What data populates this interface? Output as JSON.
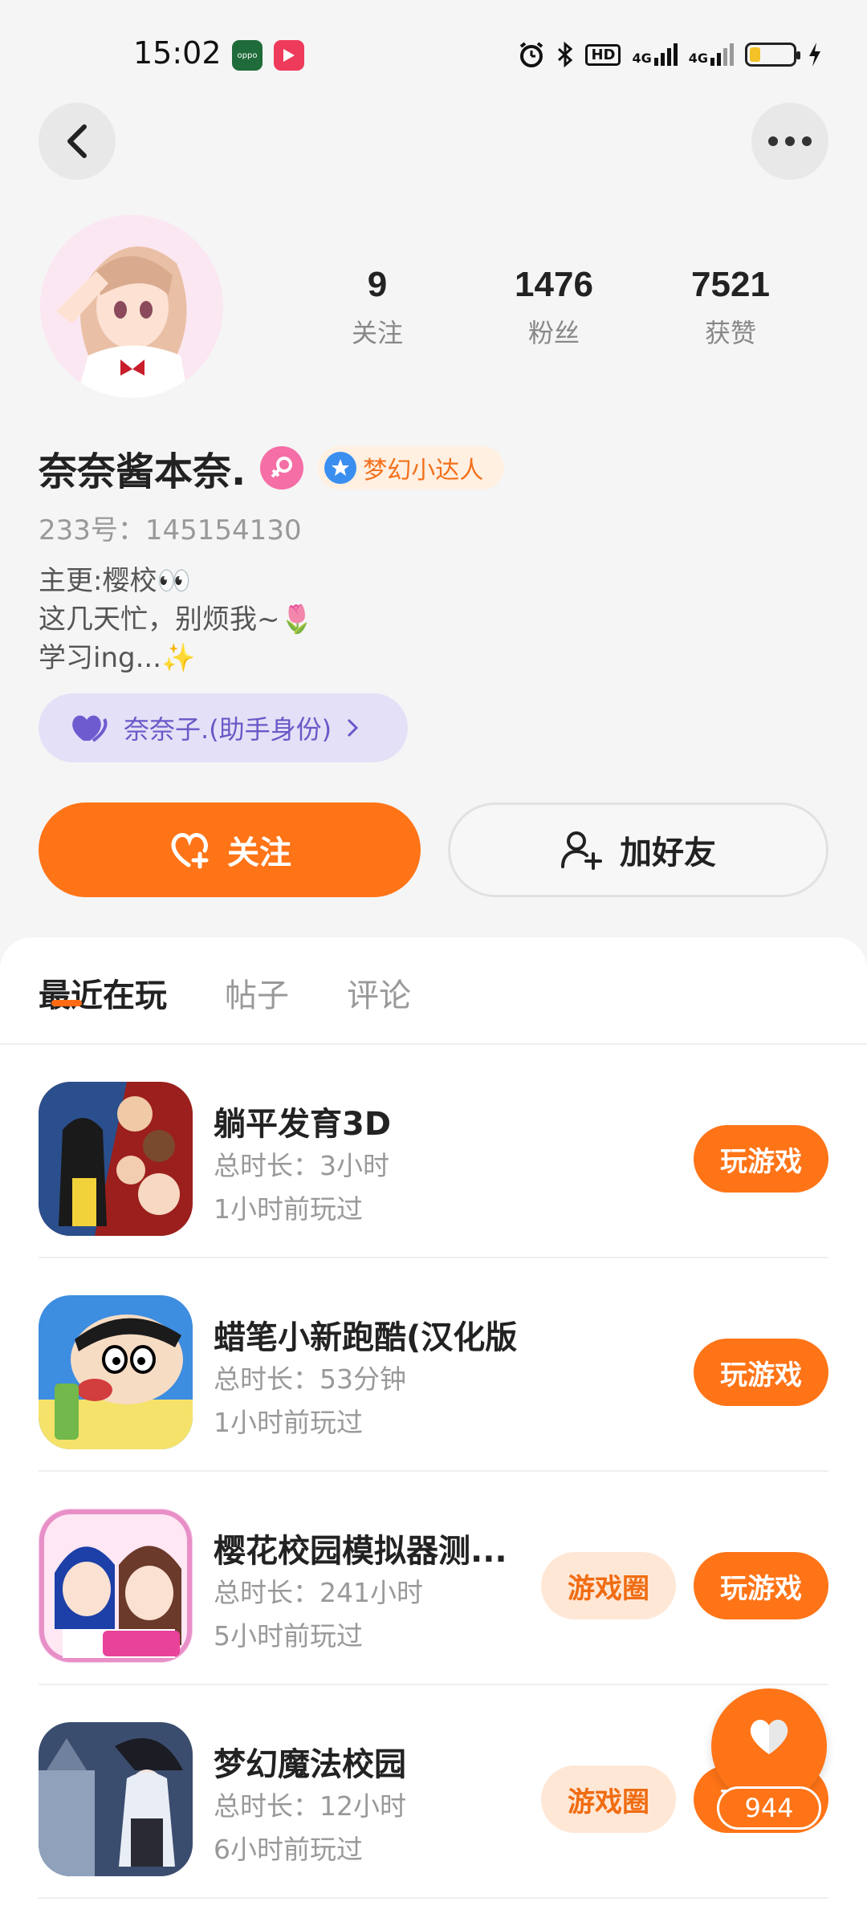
{
  "status_bar": {
    "time": "15:02",
    "app1_label": "oppo",
    "network": "4G",
    "hd_label": "HD"
  },
  "profile": {
    "stats": [
      {
        "value": "9",
        "label": "关注"
      },
      {
        "value": "1476",
        "label": "粉丝"
      },
      {
        "value": "7521",
        "label": "获赞"
      }
    ],
    "name": "奈奈酱本奈.",
    "title_badge": "梦幻小达人",
    "uid": "233号：145154130",
    "bio": [
      "主更:樱校👀",
      "这几天忙，别烦我~🌷",
      "学习ing...✨"
    ],
    "assistant_chip": "奈奈子.(助手身份)"
  },
  "actions": {
    "follow_label": "关注",
    "add_friend_label": "加好友"
  },
  "tabs": [
    "最近在玩",
    "帖子",
    "评论"
  ],
  "games": [
    {
      "name": "躺平发育3D",
      "total": "总时长：3小时",
      "last": "1小时前玩过",
      "circle": "",
      "play": "玩游戏"
    },
    {
      "name": "蜡笔小新跑酷(汉化版)",
      "total": "总时长：53分钟",
      "last": "1小时前玩过",
      "circle": "",
      "play": "玩游戏"
    },
    {
      "name": "樱花校园模拟器测...",
      "total": "总时长：241小时",
      "last": "5小时前玩过",
      "circle": "游戏圈",
      "play": "玩游戏"
    },
    {
      "name": "梦幻魔法校园",
      "total": "总时长：12小时",
      "last": "6小时前玩过",
      "circle": "游戏圈",
      "play": "玩游戏"
    }
  ],
  "like_fab": {
    "count": "944"
  },
  "colors": {
    "accent": "#ff7417",
    "assistant": "#6a58c7",
    "badge_bg": "#fff0e2"
  }
}
